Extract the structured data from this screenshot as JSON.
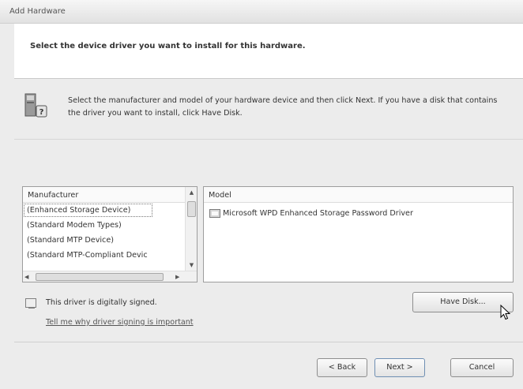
{
  "window": {
    "title": "Add Hardware"
  },
  "header": {
    "heading": "Select the device driver you want to install for this hardware."
  },
  "instruction": "Select the manufacturer and model of your hardware device and then click Next. If you have a disk that contains the driver you want to install, click Have Disk.",
  "manufacturer": {
    "header": "Manufacturer",
    "items": [
      {
        "label": "(Enhanced Storage Device)",
        "selected": true
      },
      {
        "label": "(Standard Modem Types)"
      },
      {
        "label": "(Standard MTP Device)"
      },
      {
        "label": "(Standard MTP-Compliant Devic"
      }
    ]
  },
  "model": {
    "header": "Model",
    "items": [
      {
        "label": "Microsoft WPD Enhanced Storage Password Driver",
        "icon": "device-icon"
      }
    ]
  },
  "signing": {
    "status_text": "This driver is digitally signed.",
    "link_text": "Tell me why driver signing is important",
    "icon": "signed-driver-icon"
  },
  "buttons": {
    "have_disk": "Have Disk...",
    "back": "< Back",
    "next": "Next >",
    "cancel": "Cancel"
  },
  "colors": {
    "header_bg": "#ffffff",
    "body_bg": "#ececec"
  }
}
